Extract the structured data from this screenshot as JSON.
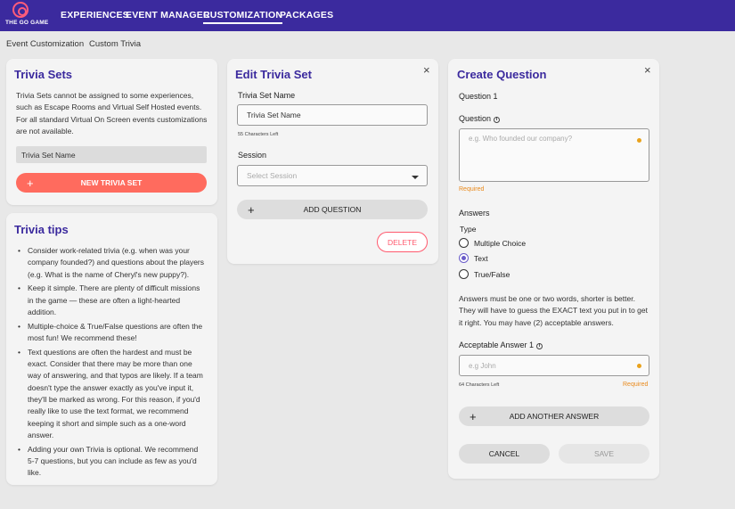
{
  "brand": {
    "logo_text": "THE GO GAME"
  },
  "nav": {
    "items": [
      "EXPERIENCES",
      "EVENT MANAGER",
      "CUSTOMIZATION",
      "PACKAGES"
    ],
    "active": "CUSTOMIZATION"
  },
  "breadcrumb": [
    "Event Customization",
    "Custom Trivia"
  ],
  "trivia_sets": {
    "title": "Trivia Sets",
    "description": "Trivia Sets cannot be assigned to some experiences, such as Escape Rooms and Virtual Self Hosted events. For all standard Virtual On Screen events customizations are not available.",
    "list_item": "Trivia Set Name",
    "new_button": "NEW TRIVIA SET"
  },
  "trivia_tips": {
    "title": "Trivia tips",
    "items": [
      "Consider work-related trivia (e.g. when was your company founded?) and questions about the players (e.g. What is the name of Cheryl's new puppy?).",
      "Keep it simple. There are plenty of difficult missions in the game — these are often a light-hearted addition.",
      "Multiple-choice & True/False questions are often the most fun! We recommend these!",
      "Text questions are often the hardest and must be exact. Consider that there may be more than one way of answering, and that typos are likely. If a team doesn't type the answer exactly as you've input it, they'll be marked as wrong. For this reason, if you'd really like to use the text format, we recommend keeping it short and simple such as a one-word answer.",
      "Adding your own Trivia is optional. We recommend 5-7 questions, but you can include as few as you'd like."
    ]
  },
  "edit_set": {
    "title": "Edit Trivia Set",
    "close": "×",
    "name_label": "Trivia Set Name",
    "name_value": "Trivia Set Name",
    "chars_left": "55 Characters Left",
    "session_label": "Session",
    "session_placeholder": "Select Session",
    "add_question": "ADD QUESTION",
    "delete": "DELETE"
  },
  "create_question": {
    "title": "Create Question",
    "close": "×",
    "question_number": "Question 1",
    "question_label": "Question",
    "question_placeholder": "e.g. Who founded our company?",
    "required": "Required",
    "answers_label": "Answers",
    "type_label": "Type",
    "types": [
      "Multiple Choice",
      "Text",
      "True/False"
    ],
    "selected_type": "Text",
    "answers_hint": "Answers must be one or two words, shorter is better. They will have to guess the EXACT text you put in to get it right. You may have (2) acceptable answers.",
    "acceptable_label": "Acceptable Answer 1",
    "acceptable_placeholder": "e.g John",
    "chars_left": "64 Characters Left",
    "required2": "Required",
    "add_answer": "ADD ANOTHER ANSWER",
    "cancel": "CANCEL",
    "save": "SAVE"
  },
  "colors": {
    "nav_bg": "#3b2a9e",
    "accent": "#ff6b5e",
    "title": "#3b2a9e",
    "required": "#e98a1c",
    "radio": "#6a5cc9"
  }
}
